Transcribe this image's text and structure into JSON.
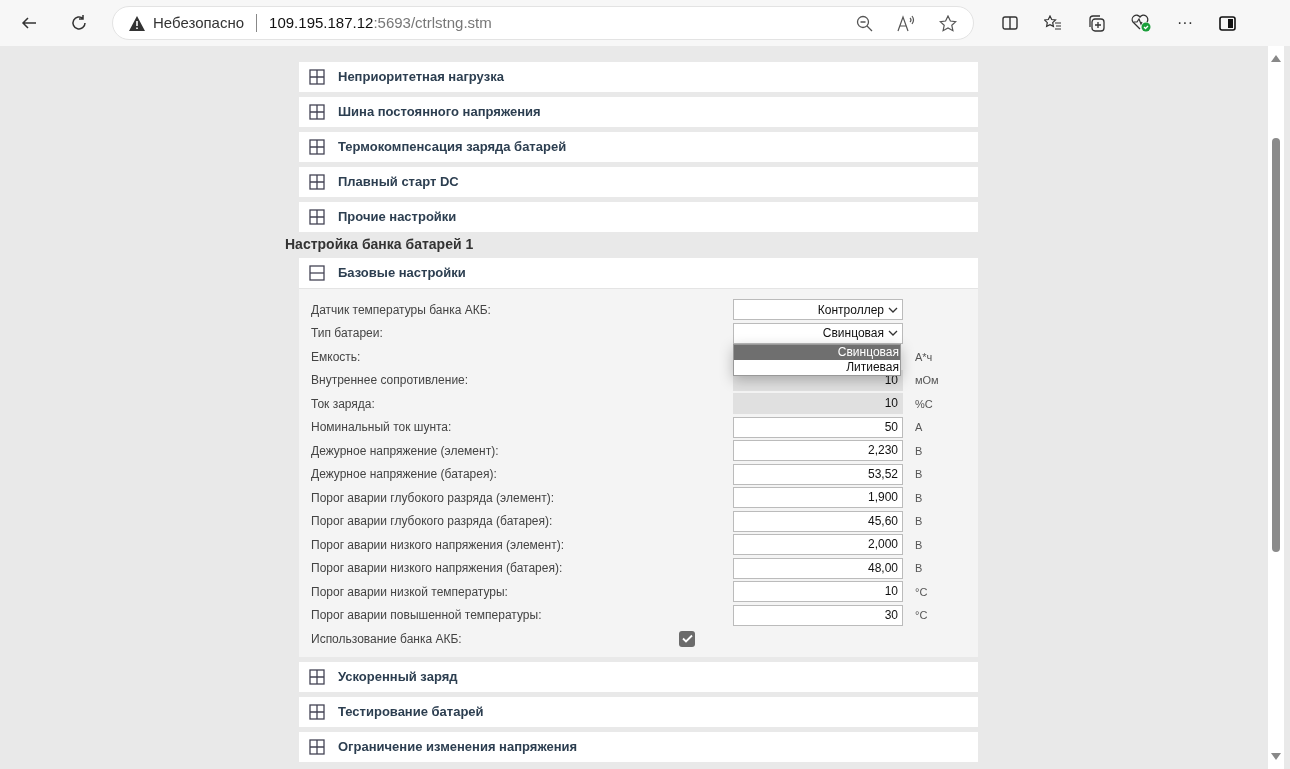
{
  "browser": {
    "security_label": "Небезопасно",
    "url_host": "109.195.187.12",
    "url_rest": ":5693/ctrlstng.stm",
    "more": "···"
  },
  "page": {
    "top_sections": [
      {
        "title": "Неприоритетная нагрузка",
        "expanded": false
      },
      {
        "title": "Шина постоянного напряжения",
        "expanded": false
      },
      {
        "title": "Термокомпенсация заряда батарей",
        "expanded": false
      },
      {
        "title": "Плавный старт DC",
        "expanded": false
      },
      {
        "title": "Прочие настройки",
        "expanded": false
      }
    ],
    "bank_heading": "Настройка банка батарей 1",
    "bank_sections": [
      {
        "title": "Базовые настройки",
        "expanded": true,
        "rows": [
          {
            "kind": "select",
            "label": "Датчик температуры банка АКБ:",
            "value": "Контроллер"
          },
          {
            "kind": "select",
            "label": "Тип батареи:",
            "value": "Свинцовая",
            "open": true,
            "options": [
              {
                "label": "Свинцовая",
                "selected": true
              },
              {
                "label": "Литиевая",
                "selected": false
              }
            ]
          },
          {
            "kind": "covered",
            "label": "Емкость:",
            "unit": "А*ч"
          },
          {
            "kind": "input",
            "label": "Внутреннее сопротивление:",
            "value": "10",
            "unit": "мОм",
            "disabled": true
          },
          {
            "kind": "input",
            "label": "Ток заряда:",
            "value": "10",
            "unit": "%С",
            "disabled": true
          },
          {
            "kind": "input",
            "label": "Номинальный ток шунта:",
            "value": "50",
            "unit": "А",
            "disabled": false
          },
          {
            "kind": "input",
            "label": "Дежурное напряжение (элемент):",
            "value": "2,230",
            "unit": "В",
            "disabled": false
          },
          {
            "kind": "input",
            "label": "Дежурное напряжение (батарея):",
            "value": "53,52",
            "unit": "В",
            "disabled": false
          },
          {
            "kind": "input",
            "label": "Порог аварии глубокого разряда (элемент):",
            "value": "1,900",
            "unit": "В",
            "disabled": false
          },
          {
            "kind": "input",
            "label": "Порог аварии глубокого разряда (батарея):",
            "value": "45,60",
            "unit": "В",
            "disabled": false
          },
          {
            "kind": "input",
            "label": "Порог аварии низкого напряжения (элемент):",
            "value": "2,000",
            "unit": "В",
            "disabled": false
          },
          {
            "kind": "input",
            "label": "Порог аварии низкого напряжения (батарея):",
            "value": "48,00",
            "unit": "В",
            "disabled": false
          },
          {
            "kind": "input",
            "label": "Порог аварии низкой температуры:",
            "value": "10",
            "unit": "°С",
            "disabled": false
          },
          {
            "kind": "input",
            "label": "Порог аварии повышенной температуры:",
            "value": "30",
            "unit": "°С",
            "disabled": false
          },
          {
            "kind": "checkbox",
            "label": "Использование банка АКБ:",
            "checked": true
          }
        ]
      },
      {
        "title": "Ускоренный заряд",
        "expanded": false
      },
      {
        "title": "Тестирование батарей",
        "expanded": false
      },
      {
        "title": "Ограничение изменения напряжения",
        "expanded": false
      }
    ]
  }
}
